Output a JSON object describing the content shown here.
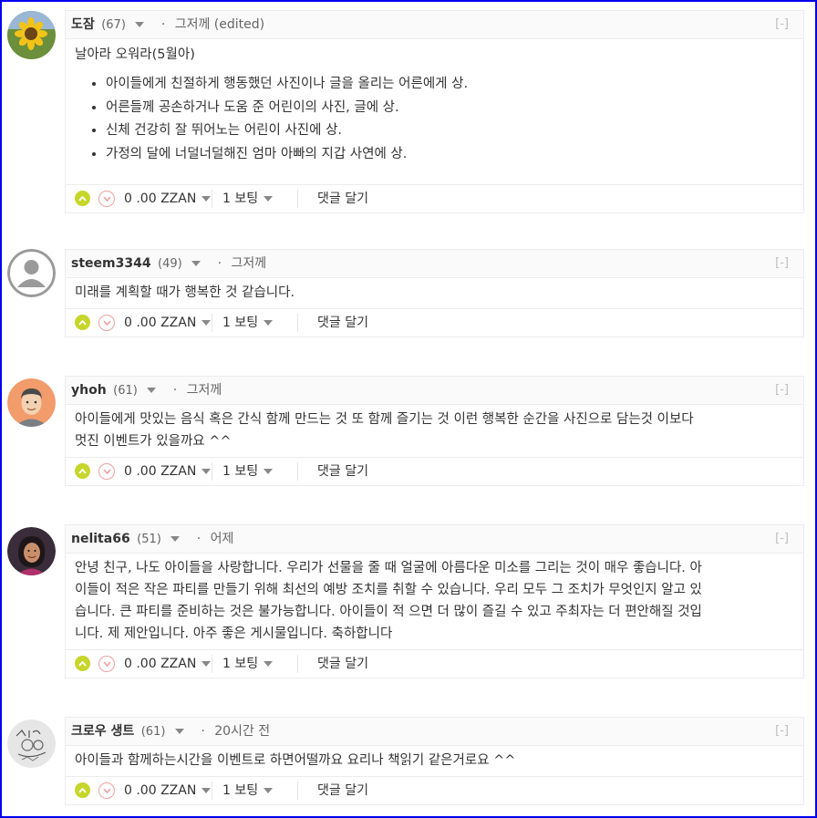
{
  "colors": {
    "frame": "#0000ee",
    "upvote": "#c6d62a",
    "downvote_border": "#f0a0a0"
  },
  "comments": [
    {
      "author": "도잠",
      "reputation": "(67)",
      "time": "그저께 (edited)",
      "collapse": "[-]",
      "title": "날아라 오워라(5월아)",
      "list": [
        "아이들에게 친절하게 행동했던 사진이나 글을 올리는 어른에게 상.",
        "어른들께 공손하거나 도움 준 어린이의 사진, 글에 상.",
        "신체 건강히 잘 뛰어노는 어린이 사진에 상.",
        "가정의 달에 너덜너덜해진 엄마 아빠의 지갑 사연에 상."
      ],
      "payout": "0 .00 ZZAN",
      "votes": "1 보팅",
      "reply": "댓글 달기",
      "avatar": "sunflower-avatar"
    },
    {
      "author": "steem3344",
      "reputation": "(49)",
      "time": "그저께",
      "collapse": "[-]",
      "lines": [
        "미래를 계획할 때가 행복한 것 같습니다."
      ],
      "payout": "0 .00 ZZAN",
      "votes": "1 보팅",
      "reply": "댓글 달기",
      "avatar": "default-user-avatar"
    },
    {
      "author": "yhoh",
      "reputation": "(61)",
      "time": "그저께",
      "collapse": "[-]",
      "lines": [
        "아이들에게 맛있는 음식 혹은 간식 함께 만드는 것 또 함께 즐기는 것 이런 행복한 순간을 사진으로 담는것 이보다",
        "멋진 이벤트가 있을까요 ^^"
      ],
      "payout": "0 .00 ZZAN",
      "votes": "1 보팅",
      "reply": "댓글 달기",
      "avatar": "man-avatar"
    },
    {
      "author": "nelita66",
      "reputation": "(51)",
      "time": "어제",
      "collapse": "[-]",
      "lines": [
        "안녕 친구, 나도 아이들을 사랑합니다. 우리가 선물을 줄 때 얼굴에 아름다운 미소를 그리는 것이 매우 좋습니다. 아",
        "이들이 적은 작은 파티를 만들기 위해 최선의 예방 조치를 취할 수 있습니다. 우리 모두 그 조치가 무엇인지 알고 있",
        "습니다. 큰 파티를 준비하는 것은 불가능합니다. 아이들이 적 으면 더 많이 즐길 수 있고 주최자는 더 편안해질 것입",
        "니다. 제 제안입니다. 아주 좋은 게시물입니다. 축하합니다"
      ],
      "payout": "0 .00 ZZAN",
      "votes": "1 보팅",
      "reply": "댓글 달기",
      "avatar": "woman-avatar"
    },
    {
      "author": "크로우 생트",
      "reputation": "(61)",
      "time": "20시간 전",
      "collapse": "[-]",
      "lines": [
        "아이들과 함께하는시간을 이벤트로 하면어떨까요 요리나 책읽기 같은거로요 ^^"
      ],
      "payout": "0 .00 ZZAN",
      "votes": "1 보팅",
      "reply": "댓글 달기",
      "avatar": "sketch-avatar"
    }
  ]
}
